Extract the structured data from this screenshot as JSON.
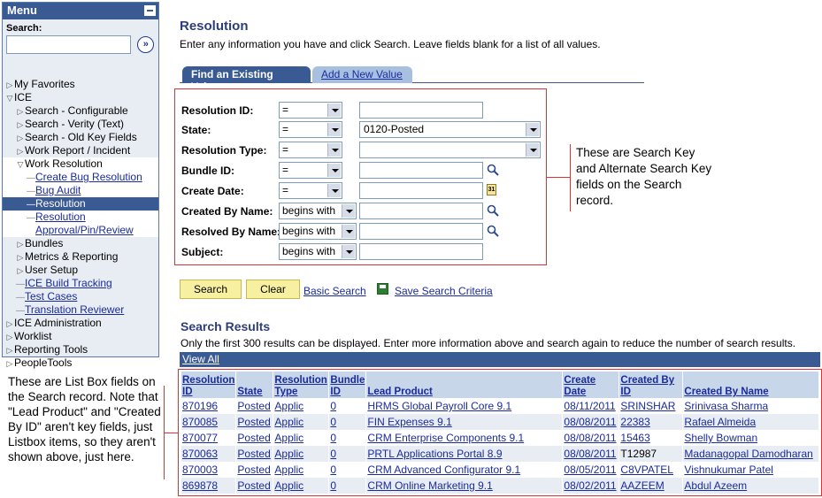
{
  "sidebar": {
    "header": "Menu",
    "search_label": "Search:",
    "search_value": "",
    "items": [
      {
        "label": "My Favorites",
        "marker": "right",
        "level": 0
      },
      {
        "label": "ICE",
        "marker": "down",
        "level": 0
      },
      {
        "label": "Search - Configurable",
        "marker": "right",
        "level": 1
      },
      {
        "label": "Search - Verity (Text)",
        "marker": "right",
        "level": 1
      },
      {
        "label": "Search - Old Key Fields",
        "marker": "right",
        "level": 1
      },
      {
        "label": "Work Report / Incident",
        "marker": "right",
        "level": 1
      },
      {
        "label": "Work Resolution",
        "marker": "down",
        "level": 1
      },
      {
        "label": "Create Bug Resolution",
        "marker": "dash",
        "level": 2
      },
      {
        "label": "Bug Audit",
        "marker": "dash",
        "level": 2
      },
      {
        "label": "Resolution",
        "marker": "dash",
        "level": 2
      },
      {
        "label": "Resolution",
        "marker": "dash",
        "level": 2
      },
      {
        "label": "Approval/Pin/Review",
        "marker": "none",
        "level": 2
      },
      {
        "label": "Bundles",
        "marker": "right",
        "level": 1
      },
      {
        "label": "Metrics & Reporting",
        "marker": "right",
        "level": 1
      },
      {
        "label": "User Setup",
        "marker": "right",
        "level": 1
      },
      {
        "label": "ICE Build Tracking",
        "marker": "dash",
        "level": 1
      },
      {
        "label": "Test Cases",
        "marker": "dash",
        "level": 1
      },
      {
        "label": "Translation Reviewer",
        "marker": "dash",
        "level": 1
      },
      {
        "label": "ICE Administration",
        "marker": "right",
        "level": 0
      },
      {
        "label": "Worklist",
        "marker": "right",
        "level": 0
      },
      {
        "label": "Reporting Tools",
        "marker": "right",
        "level": 0
      },
      {
        "label": "PeopleTools",
        "marker": "right",
        "level": 0
      }
    ]
  },
  "page": {
    "title": "Resolution",
    "instructions": "Enter any information you have and click Search. Leave fields blank for a list of all values."
  },
  "tabs": {
    "find": "Find an Existing Value",
    "add": "Add a New Value"
  },
  "criteria": {
    "resolution_id": {
      "label": "Resolution ID:",
      "op": "=",
      "value": ""
    },
    "state": {
      "label": "State:",
      "op": "=",
      "value": "0120-Posted"
    },
    "resolution_type": {
      "label": "Resolution Type:",
      "op": "=",
      "value": ""
    },
    "bundle_id": {
      "label": "Bundle ID:",
      "op": "=",
      "value": ""
    },
    "create_date": {
      "label": "Create Date:",
      "op": "=",
      "value": ""
    },
    "created_by": {
      "label": "Created By Name:",
      "op": "begins with",
      "value": ""
    },
    "resolved_by": {
      "label": "Resolved By Name:",
      "op": "begins with",
      "value": ""
    },
    "subject": {
      "label": "Subject:",
      "op": "begins with",
      "value": ""
    }
  },
  "callouts": {
    "search_keys": "These are Search Key and Alternate Search Key fields on the Search record.",
    "list_box": "These are List Box fields on the Search record. Note that \"Lead Product\" and \"Created By ID\" aren't key fields, just Listbox items, so they aren't shown above, just here."
  },
  "actions": {
    "search": "Search",
    "clear": "Clear",
    "basic_search": "Basic Search",
    "save_criteria": "Save Search Criteria"
  },
  "results": {
    "title": "Search Results",
    "note": "Only the first 300 results can be displayed. Enter more information above and search again to reduce the number of search results.",
    "view_all": "View All",
    "columns": [
      "Resolution ID",
      "State",
      "Resolution Type",
      "Bundle ID",
      "Lead Product",
      "Create Date",
      "Created By ID",
      "Created By Name"
    ],
    "rows": [
      [
        "870196",
        "Posted",
        "Applic",
        "0",
        "HRMS Global Payroll Core 9.1",
        "08/11/2011",
        "SRINSHAR",
        "Srinivasa Sharma"
      ],
      [
        "870085",
        "Posted",
        "Applic",
        "0",
        "FIN Expenses 9.1",
        "08/08/2011",
        "22383",
        "Rafael Almeida"
      ],
      [
        "870077",
        "Posted",
        "Applic",
        "0",
        "CRM Enterprise Components 9.1",
        "08/08/2011",
        "15463",
        "Shelly Bowman"
      ],
      [
        "870063",
        "Posted",
        "Applic",
        "0",
        "PRTL Applications Portal 8.9",
        "08/08/2011",
        "T12987",
        "Madanagopal Damodharan"
      ],
      [
        "870003",
        "Posted",
        "Applic",
        "0",
        "CRM Advanced Configurator 9.1",
        "08/05/2011",
        "C8VPATEL",
        "Vishnukumar Patel"
      ],
      [
        "869878",
        "Posted",
        "Applic",
        "0",
        "CRM Online Marketing 9.1",
        "08/02/2011",
        "AAZEEM",
        "Abdul Azeem"
      ]
    ]
  }
}
